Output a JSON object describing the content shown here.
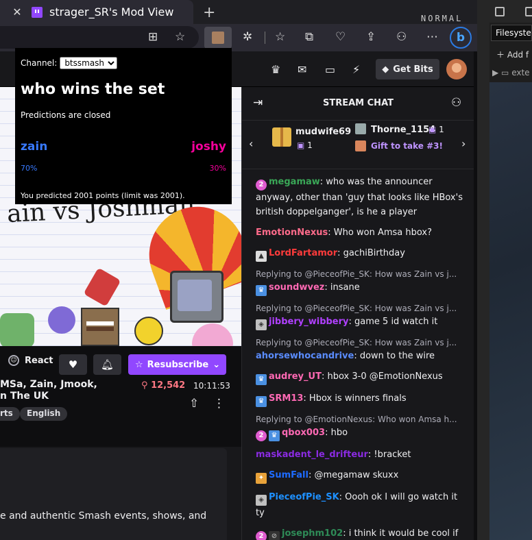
{
  "browser": {
    "tab_close": "✕",
    "tab_title": "strager_SR's Mod View",
    "new_tab": "+",
    "mode_indicator": "NORMAL"
  },
  "twitch_nav": {
    "get_bits_label": "Get Bits"
  },
  "prediction": {
    "channel_label": "Channel:",
    "channel_selected": "btssmash",
    "question": "who wins the set",
    "status": "Predictions are closed",
    "outcome_left": "zain",
    "outcome_right": "joshy",
    "pct_left": "70%",
    "pct_right": "30%",
    "left_color": "#387aff",
    "right_color": "#f5009b",
    "note": "You predicted 2001 points (limit was 2001)."
  },
  "video": {
    "overlay_text": "ain vs Joshman"
  },
  "stream_info": {
    "react_label": "React",
    "resubscribe_label": "Resubscribe",
    "title_line1": "MSa, Zain, Jmook,",
    "title_line2": "n The UK",
    "viewers": "12,542",
    "uptime": "10:11:53",
    "tag1": "rts",
    "tag2": "English",
    "about_text": "e and authentic Smash events, shows, and"
  },
  "chat": {
    "header": "STREAM CHAT",
    "leader1_name": "mudwife69",
    "leader1_count": "1",
    "leader2_name": "Thorne_1154",
    "leader2_count": "1",
    "leader3_text": "Gift to take #3!",
    "messages": [
      {
        "user": "megamaw",
        "color": "#3aa757",
        "text": ": who was the announcer anyway, other than 'guy that looks like HBox's british doppelganger', is he a player"
      },
      {
        "user": "EmotionNexus",
        "color": "#ff6b8b",
        "text": ": Who won Amsa hbox?"
      },
      {
        "user": "LordFartamor",
        "color": "#ff3b3b",
        "text": ": gachiBirthday"
      },
      {
        "reply": "Replying to @PieceofPie_SK: How was Zain vs j...",
        "user": "soundwvez",
        "color": "#ff69b4",
        "text": ": insane"
      },
      {
        "reply": "Replying to @PieceofPie_SK: How was Zain vs j...",
        "user": "jibbery_wibbery",
        "color": "#b040ff",
        "text": ": game 5 id watch it"
      },
      {
        "reply": "Replying to @PieceofPie_SK: How was Zain vs j...",
        "user": "ahorsewhocandrive",
        "color": "#5a8cff",
        "text": ": down to the wire"
      },
      {
        "user": "audrey_UT",
        "color": "#ff69b4",
        "text": ": hbox 3-0 @EmotionNexus"
      },
      {
        "user": "SRM13",
        "color": "#ff69b4",
        "text": ": Hbox is winners finals"
      },
      {
        "reply": "Replying to @EmotionNexus: Who won Amsa h...",
        "user": "qbox003",
        "color": "#ff69b4",
        "text": ": hbo"
      },
      {
        "user": "maskadent_le_drifteur",
        "color": "#8a2be2",
        "text": ": !bracket"
      },
      {
        "user": "SumFall",
        "color": "#1e6bff",
        "text": ": @megamaw skuxx"
      },
      {
        "user": "PieceofPie_SK",
        "color": "#1e90ff",
        "text": ": Oooh ok I will go watch it ty"
      },
      {
        "user": "josephm102",
        "color": "#2e8b57",
        "text": ": i think it would be cool if Josh won this"
      }
    ]
  },
  "devtools": {
    "filesystem_label": "Filesystem",
    "add_label": "Add f",
    "ext_label": "exte"
  }
}
